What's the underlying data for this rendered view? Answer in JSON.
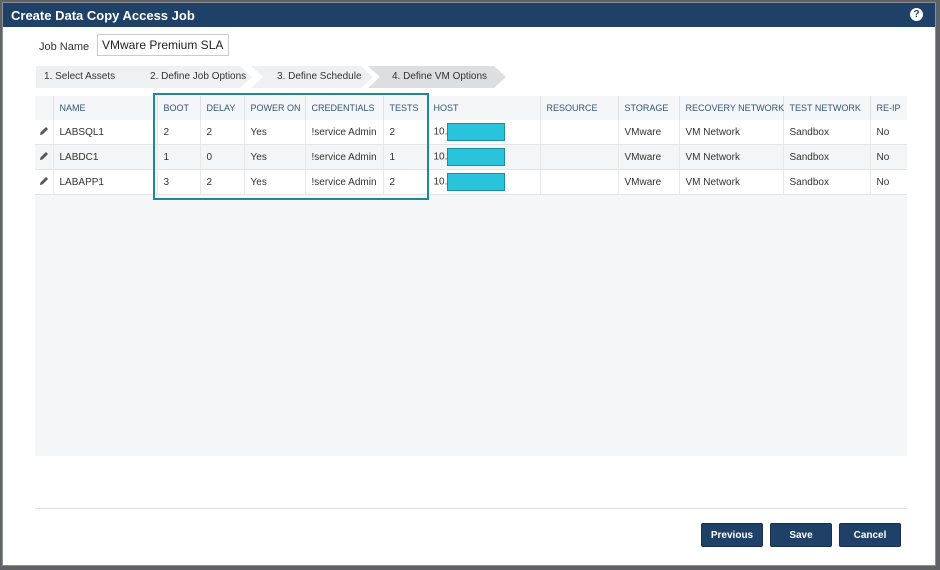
{
  "dialog": {
    "title": "Create Data Copy Access Job",
    "help_glyph": "?"
  },
  "job_name": {
    "label": "Job Name",
    "value": "VMware Premium SLA"
  },
  "steps": [
    {
      "label": "1. Select Assets",
      "active": false
    },
    {
      "label": "2. Define Job Options",
      "active": false
    },
    {
      "label": "3. Define Schedule",
      "active": false
    },
    {
      "label": "4. Define VM Options",
      "active": true
    }
  ],
  "table": {
    "headers": [
      "NAME",
      "BOOT",
      "DELAY",
      "POWER ON",
      "CREDENTIALS",
      "TESTS",
      "HOST",
      "RESOURCE",
      "STORAGE",
      "RECOVERY NETWORK",
      "TEST NETWORK",
      "RE-IP"
    ],
    "rows": [
      {
        "name": "LABSQL1",
        "boot": "2",
        "delay": "2",
        "power_on": "Yes",
        "credentials": "!service Admin",
        "tests": "2",
        "host": "10.",
        "resource": "",
        "storage": "VMware",
        "recovery_network": "VM Network",
        "test_network": "Sandbox",
        "re_ip": "No"
      },
      {
        "name": "LABDC1",
        "boot": "1",
        "delay": "0",
        "power_on": "Yes",
        "credentials": "!service Admin",
        "tests": "1",
        "host": "10.",
        "resource": "",
        "storage": "VMware",
        "recovery_network": "VM Network",
        "test_network": "Sandbox",
        "re_ip": "No"
      },
      {
        "name": "LABAPP1",
        "boot": "3",
        "delay": "2",
        "power_on": "Yes",
        "credentials": "!service Admin",
        "tests": "2",
        "host": "10.",
        "resource": "",
        "storage": "VMware",
        "recovery_network": "VM Network",
        "test_network": "Sandbox",
        "re_ip": "No"
      }
    ]
  },
  "buttons": {
    "previous": "Previous",
    "save": "Save",
    "cancel": "Cancel"
  },
  "colors": {
    "titlebar": "#1f4168",
    "button": "#1f4168",
    "highlight": "#1b8a96",
    "redaction": "#2ac3dc",
    "active_step": "#dcdedf",
    "inactive_step": "#eef0f1"
  }
}
